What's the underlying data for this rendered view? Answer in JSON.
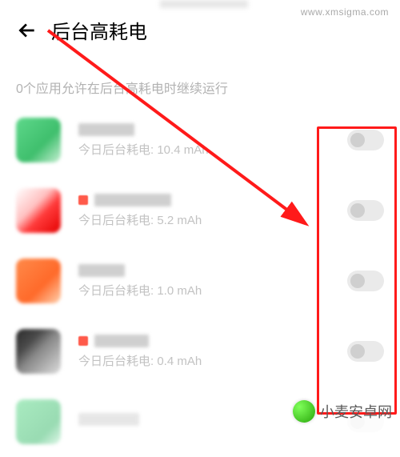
{
  "header": {
    "title": "后台高耗电"
  },
  "subtitle": "0个应用允许在后台高耗电时继续运行",
  "label_prefix": "今日后台耗电: ",
  "apps": [
    {
      "consumption": "10.4 mAh",
      "enabled": false
    },
    {
      "consumption": "5.2 mAh",
      "enabled": false
    },
    {
      "consumption": "1.0 mAh",
      "enabled": false
    },
    {
      "consumption": "0.4 mAh",
      "enabled": false
    },
    {
      "consumption": "",
      "enabled": false
    }
  ],
  "watermark": {
    "top": "www.xmsigma.com",
    "bottom_text": "小麦安卓网"
  },
  "annotation": {
    "highlight_color": "#ff1a1a"
  }
}
